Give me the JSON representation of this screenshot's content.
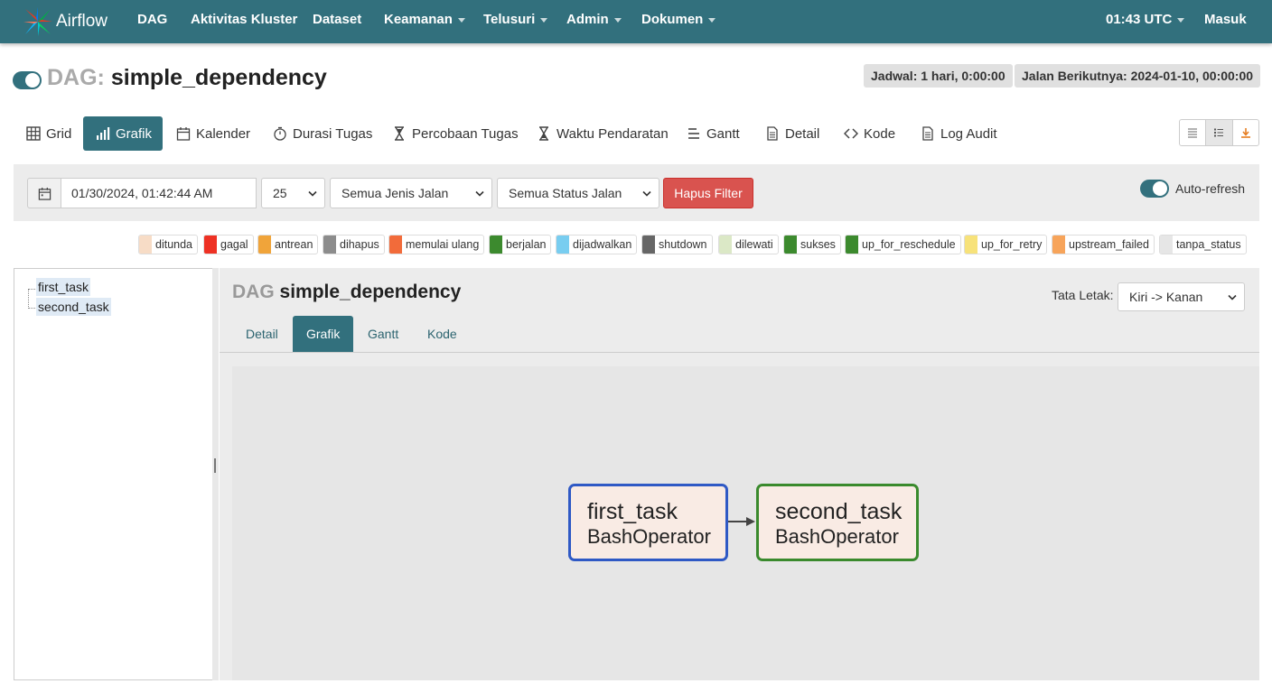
{
  "navbar": {
    "brand": "Airflow",
    "items": [
      {
        "label": "DAG",
        "dropdown": false
      },
      {
        "label": "Aktivitas Kluster",
        "dropdown": false
      },
      {
        "label": "Dataset",
        "dropdown": false
      },
      {
        "label": "Keamanan",
        "dropdown": true
      },
      {
        "label": "Telusuri",
        "dropdown": true
      },
      {
        "label": "Admin",
        "dropdown": true
      },
      {
        "label": "Dokumen",
        "dropdown": true
      }
    ],
    "time": "01:43 UTC",
    "login": "Masuk"
  },
  "header": {
    "dag_prefix": "DAG:",
    "dag_id": "simple_dependency",
    "schedule": "Jadwal: 1 hari, 0:00:00",
    "next_run": "Jalan Berikutnya: 2024-01-10, 00:00:00"
  },
  "views": [
    {
      "label": "Grid",
      "icon": "grid-icon"
    },
    {
      "label": "Grafik",
      "icon": "graph-icon",
      "active": true
    },
    {
      "label": "Kalender",
      "icon": "calendar-icon"
    },
    {
      "label": "Durasi Tugas",
      "icon": "stopwatch-icon"
    },
    {
      "label": "Percobaan Tugas",
      "icon": "hourglass-icon"
    },
    {
      "label": "Waktu Pendaratan",
      "icon": "hourglass-icon"
    },
    {
      "label": "Gantt",
      "icon": "gantt-icon"
    },
    {
      "label": "Detail",
      "icon": "document-icon"
    },
    {
      "label": "Kode",
      "icon": "code-icon"
    },
    {
      "label": "Log Audit",
      "icon": "document-icon"
    }
  ],
  "filters": {
    "date": "01/30/2024, 01:42:44 AM",
    "num_runs": "25",
    "run_type": "Semua Jenis Jalan",
    "run_state": "Semua Status Jalan",
    "clear": "Hapus Filter",
    "auto_refresh": "Auto-refresh"
  },
  "legend": [
    {
      "label": "ditunda",
      "color": "#f7dcc6"
    },
    {
      "label": "gagal",
      "color": "#ee3124"
    },
    {
      "label": "antrean",
      "color": "#f0a43a"
    },
    {
      "label": "dihapus",
      "color": "#8c8c8c"
    },
    {
      "label": "memulai ulang",
      "color": "#f26b3a"
    },
    {
      "label": "berjalan",
      "color": "#3c8a2e"
    },
    {
      "label": "dijadwalkan",
      "color": "#78cdf0"
    },
    {
      "label": "shutdown",
      "color": "#666666"
    },
    {
      "label": "dilewati",
      "color": "#dbe8c6"
    },
    {
      "label": "sukses",
      "color": "#3c8a2e"
    },
    {
      "label": "up_for_reschedule",
      "color": "#3c8a2e"
    },
    {
      "label": "up_for_retry",
      "color": "#f7e27a"
    },
    {
      "label": "upstream_failed",
      "color": "#f7a45a"
    },
    {
      "label": "tanpa_status",
      "color": "#e6e6e6"
    }
  ],
  "tree": [
    "first_task",
    "second_task"
  ],
  "panel": {
    "prefix": "DAG",
    "title": "simple_dependency",
    "layout_label": "Tata Letak:",
    "layout_value": "Kiri -> Kanan",
    "tabs": [
      {
        "label": "Detail"
      },
      {
        "label": "Grafik",
        "active": true
      },
      {
        "label": "Gantt"
      },
      {
        "label": "Kode"
      }
    ]
  },
  "graph": {
    "nodes": [
      {
        "id": "first_task",
        "operator": "BashOperator",
        "border": "#2f59c5"
      },
      {
        "id": "second_task",
        "operator": "BashOperator",
        "border": "#3a8a2d"
      }
    ]
  }
}
